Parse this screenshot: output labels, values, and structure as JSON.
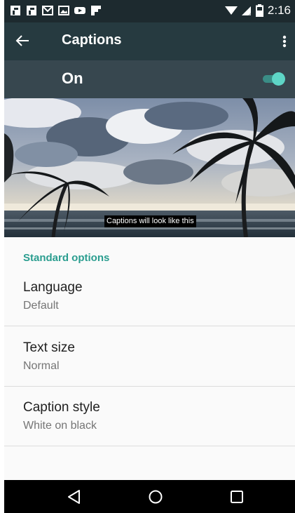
{
  "status_bar": {
    "time": "2:16",
    "left_icons": [
      "flipboard-icon",
      "flipboard-icon",
      "gmail-icon",
      "image-icon",
      "youtube-icon",
      "flipboard-icon"
    ],
    "right_icons": [
      "wifi-icon",
      "signal-icon",
      "battery-icon"
    ]
  },
  "toolbar": {
    "title": "Captions",
    "back_icon": "arrow-back-icon",
    "overflow_icon": "more-vert-icon"
  },
  "master_switch": {
    "label": "On",
    "checked": true,
    "accent": "#5ed5c6"
  },
  "preview": {
    "caption_text": "Captions will look like this"
  },
  "section": {
    "header": "Standard options",
    "color": "#2a9d8f"
  },
  "preferences": [
    {
      "title": "Language",
      "summary": "Default"
    },
    {
      "title": "Text size",
      "summary": "Normal"
    },
    {
      "title": "Caption style",
      "summary": "White on black"
    }
  ],
  "nav_bar": {
    "icons": [
      "back-triangle-icon",
      "home-circle-icon",
      "recents-square-icon"
    ]
  },
  "colors": {
    "status_bar": "#1d2a2f",
    "toolbar": "#263a40",
    "switch_bar": "#37474f"
  }
}
